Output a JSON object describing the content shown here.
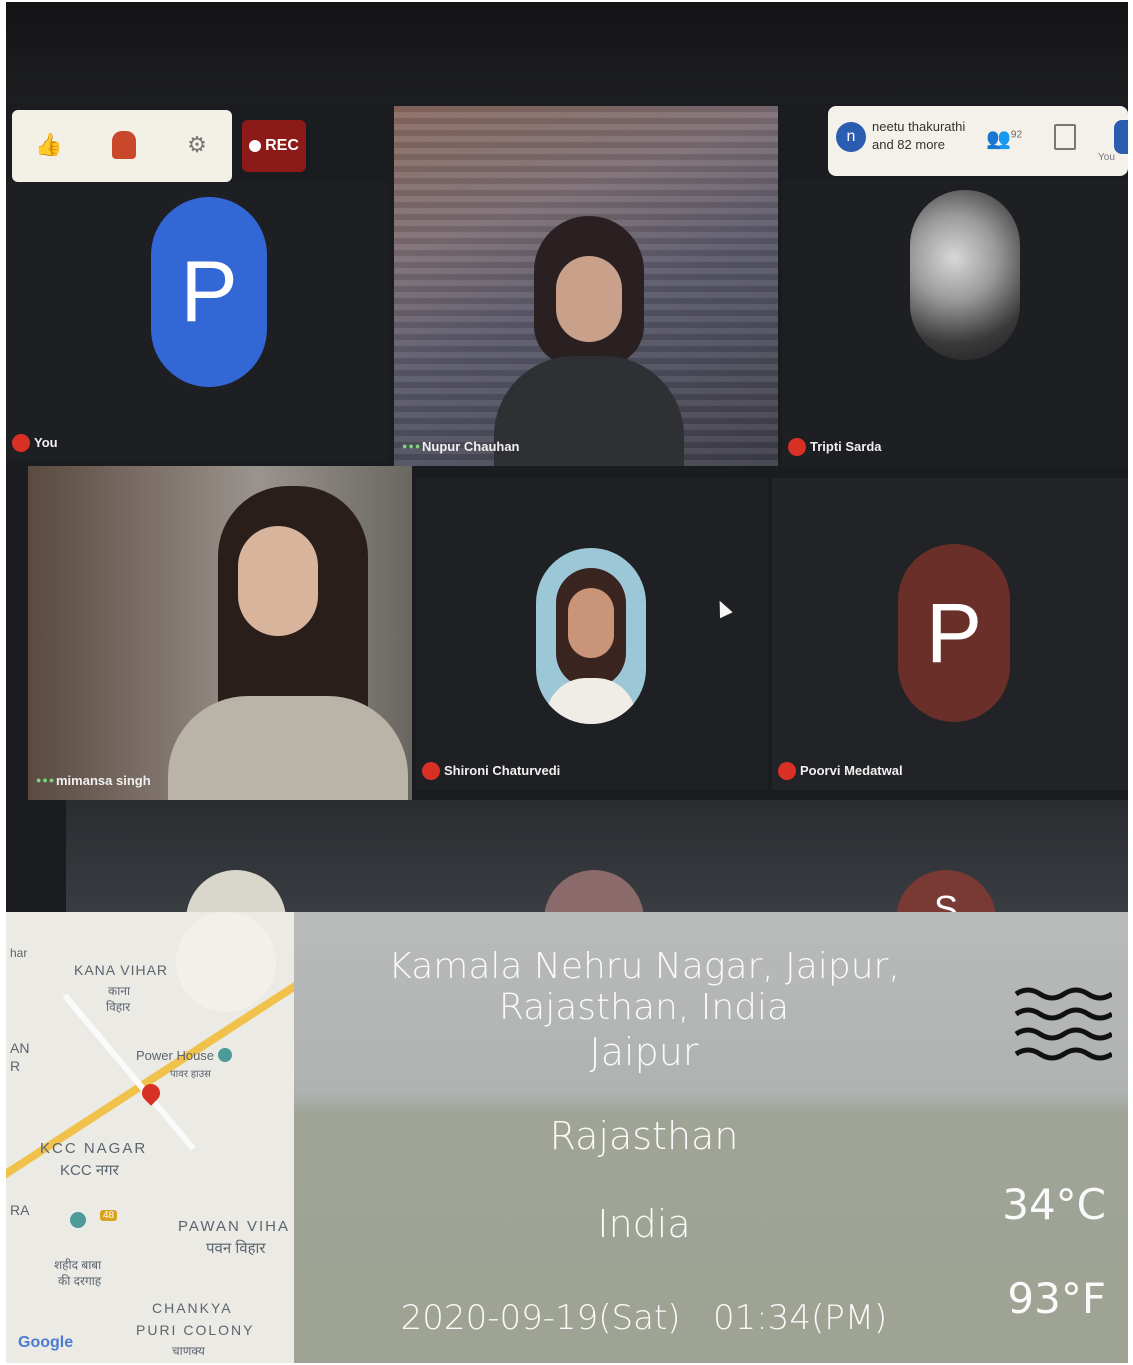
{
  "meeting": {
    "toolbar_left": {
      "icons": [
        "thumbs-up-icon",
        "raise-hand-icon",
        "settings-icon"
      ],
      "rec_label": "REC"
    },
    "toolbar_right": {
      "avatar_letter": "n",
      "participants_text_1": "neetu thakurathi",
      "participants_text_2": "and 82 more",
      "people_count": "92",
      "you_label": "You"
    },
    "tiles": [
      {
        "name": "You",
        "avatar_letter": "P",
        "avatar_color": "#3367d6"
      },
      {
        "name": "Nupur Chauhan",
        "type": "video"
      },
      {
        "name": "Tripti Sarda",
        "type": "photo"
      },
      {
        "name": "mimansa singh",
        "type": "video"
      },
      {
        "name": "Shironi Chaturvedi",
        "type": "photo"
      },
      {
        "name": "Poorvi Medatwal",
        "avatar_letter": "P",
        "avatar_color": "#6b2f2a"
      }
    ],
    "partial_row": {
      "avatar_letter": "S"
    }
  },
  "location_stamp": {
    "map": {
      "labels": [
        {
          "text": "har"
        },
        {
          "text": "KANA VIHAR"
        },
        {
          "text": "काना"
        },
        {
          "text": "विहार"
        },
        {
          "text": "AN"
        },
        {
          "text": "R"
        },
        {
          "text": "Power House"
        },
        {
          "text": "पावर हाउस"
        },
        {
          "text": "KCC NAGAR"
        },
        {
          "text": "KCC नगर"
        },
        {
          "text": "RA"
        },
        {
          "text": "48"
        },
        {
          "text": "PAWAN VIHA"
        },
        {
          "text": "पवन विहार"
        },
        {
          "text": "शहीद बाबा"
        },
        {
          "text": "की दरगाह"
        },
        {
          "text": "CHANKYA"
        },
        {
          "text": "PURI COLONY"
        },
        {
          "text": "चाणक्य"
        },
        {
          "text": "Google"
        }
      ]
    },
    "address": "Kamala Nehru Nagar, Jaipur, Rajasthan, India",
    "city": "Jaipur",
    "state": "Rajasthan",
    "country": "India",
    "datetime": "2020-09-19(Sat)   01:34(PM)",
    "weather_icon": "haze-icon",
    "temp_c": "34°C",
    "temp_f": "93°F"
  }
}
